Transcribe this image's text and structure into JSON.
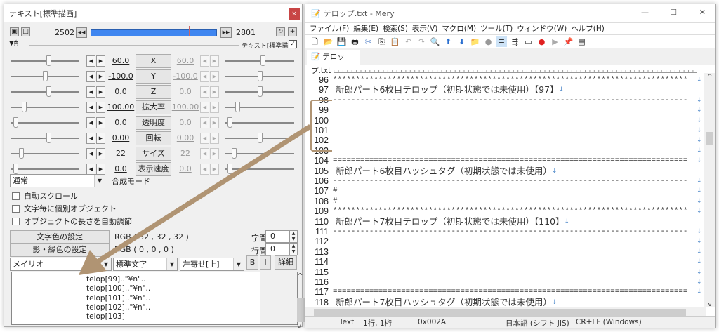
{
  "left": {
    "title": "テキスト[標準描画]",
    "close": "×",
    "frame_start": "2502",
    "frame_end": "2801",
    "prev": "◀◀",
    "next": "▶▶",
    "timeline_position": 0.78,
    "object_label": "テキスト[標準描画]",
    "params": [
      {
        "label": "X",
        "start": "60.0",
        "end": "60.0",
        "slider": 0.55,
        "slider_end": 0.55
      },
      {
        "label": "Y",
        "start": "-100.0",
        "end": "-100.0",
        "slider": 0.5,
        "slider_end": 0.5
      },
      {
        "label": "Z",
        "start": "0.0",
        "end": "0.0",
        "slider": 0.55,
        "slider_end": 0.5
      },
      {
        "label": "拡大率",
        "start": "100.00",
        "end": "100.00",
        "slider": 0.17,
        "slider_end": 0.15
      },
      {
        "label": "透明度",
        "start": "0.0",
        "end": "0.0",
        "slider": 0.03,
        "slider_end": 0.03
      },
      {
        "label": "回転",
        "start": "0.00",
        "end": "0.00",
        "slider": 0.55,
        "slider_end": 0.5
      },
      {
        "label": "サイズ",
        "start": "22",
        "end": "22",
        "slider": 0.12,
        "slider_end": 0.1
      },
      {
        "label": "表示速度",
        "start": "0.0",
        "end": "0.0",
        "slider": 0.03,
        "slider_end": 0.03
      }
    ],
    "blend_mode": "通常",
    "blend_label": "合成モード",
    "checkboxes": [
      "自動スクロール",
      "文字毎に個別オブジェクト",
      "オブジェクトの長さを自動調節"
    ],
    "text_color_btn": "文字色の設定",
    "text_color_value": "RGB ( 32 , 32 , 32 )",
    "shadow_color_btn": "影・縁色の設定",
    "shadow_color_value": "RGB ( 0 , 0 , 0 )",
    "char_spacing_label": "字間",
    "char_spacing": "0",
    "line_spacing_label": "行間",
    "line_spacing": "0",
    "font": "メイリオ",
    "style": "標準文字",
    "align": "左寄せ[上]",
    "bold": "B",
    "italic": "I",
    "detail": "詳細",
    "text_lines": [
      "telop[99]..\"¥n\"..",
      "telop[100]..\"¥n\"..",
      "telop[101]..\"¥n\"..",
      "telop[102]..\"¥n\"..",
      "telop[103]"
    ]
  },
  "right": {
    "title": "テロップ.txt - Mery",
    "menu": [
      "ファイル(F)",
      "編集(E)",
      "検索(S)",
      "表示(V)",
      "マクロ(M)",
      "ツール(T)",
      "ウィンドウ(W)",
      "ヘルプ(H)"
    ],
    "tab": "テロップ.txt",
    "lines": [
      {
        "n": "96",
        "t": "******************************************************************************"
      },
      {
        "n": "97",
        "t": " 新郎パート6枚目テロップ（初期状態では未使用）【97】",
        "jp": true
      },
      {
        "n": "98",
        "t": "------------------------------------------------------------------------------"
      },
      {
        "n": "99",
        "t": ""
      },
      {
        "n": "100",
        "t": ""
      },
      {
        "n": "101",
        "t": ""
      },
      {
        "n": "102",
        "t": ""
      },
      {
        "n": "103",
        "t": ""
      },
      {
        "n": "104",
        "t": "=============================================================================="
      },
      {
        "n": "105",
        "t": " 新郎パート6枚目ハッシュタグ（初期状態では未使用）",
        "jp": true
      },
      {
        "n": "106",
        "t": "------------------------------------------------------------------------------"
      },
      {
        "n": "107",
        "t": "#"
      },
      {
        "n": "108",
        "t": "#"
      },
      {
        "n": "109",
        "t": "******************************************************************************"
      },
      {
        "n": "110",
        "t": " 新郎パート7枚目テロップ（初期状態では未使用）【110】",
        "jp": true
      },
      {
        "n": "111",
        "t": "------------------------------------------------------------------------------"
      },
      {
        "n": "112",
        "t": ""
      },
      {
        "n": "113",
        "t": ""
      },
      {
        "n": "114",
        "t": ""
      },
      {
        "n": "115",
        "t": ""
      },
      {
        "n": "116",
        "t": ""
      },
      {
        "n": "117",
        "t": "=============================================================================="
      },
      {
        "n": "118",
        "t": " 新郎パート7枚目ハッシュタグ（初期状態では未使用）",
        "jp": true
      }
    ],
    "status": {
      "mode": "Text",
      "pos": "1行, 1桁",
      "code": "0x002A",
      "encoding": "日本語 (シフト JIS)",
      "eol": "CR+LF (Windows)"
    }
  },
  "colors": {
    "timeline": "#3f86f0",
    "annotation": "#b09473",
    "close": "#c84545"
  }
}
